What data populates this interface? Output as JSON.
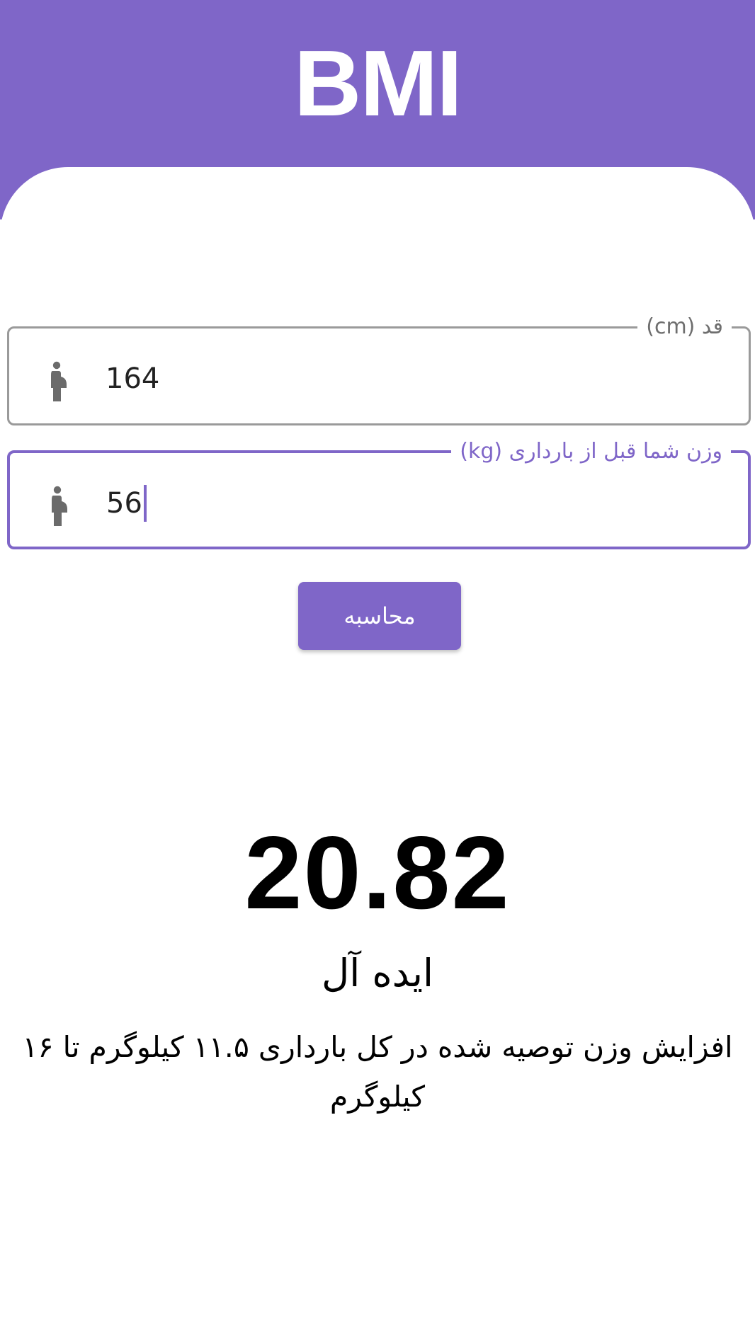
{
  "header": {
    "title": "BMI"
  },
  "form": {
    "height_field": {
      "label": "قد (cm)",
      "value": "164",
      "icon": "pregnant-woman-icon"
    },
    "weight_field": {
      "label": "وزن شما قبل از بارداری (kg)",
      "value": "56",
      "icon": "pregnant-woman-icon"
    },
    "calculate_label": "محاسبه"
  },
  "result": {
    "bmi": "20.82",
    "status": "ایده آل",
    "advice": "افزایش وزن توصیه شده در کل بارداری ۱۱.۵ کیلوگرم تا ۱۶ کیلوگرم"
  },
  "colors": {
    "accent": "#7f66c8",
    "outline_inactive": "#9a9a9a",
    "icon": "#6b6b6b",
    "text": "#000000"
  }
}
